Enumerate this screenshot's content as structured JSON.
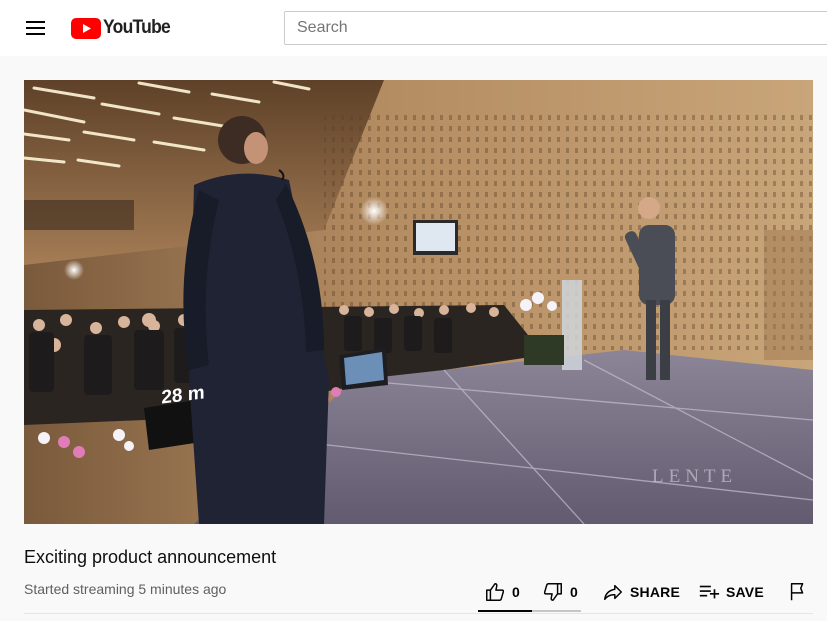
{
  "header": {
    "menu_icon": "hamburger-menu-icon",
    "logo_text": "YouTube",
    "logo_icon": "youtube-play-icon",
    "brand_color": "#FF0000",
    "search": {
      "placeholder": "Search",
      "value": ""
    }
  },
  "player": {
    "overlay_sign_text": "28 m",
    "watermark_text": "LENTE"
  },
  "video": {
    "title": "Exciting product announcement",
    "status": "Started streaming 5 minutes ago"
  },
  "actions": {
    "like_count": "0",
    "dislike_count": "0",
    "share_label": "SHARE",
    "save_label": "SAVE",
    "like_icon": "thumbs-up-icon",
    "dislike_icon": "thumbs-down-icon",
    "share_icon": "share-arrow-icon",
    "save_icon": "playlist-add-icon",
    "report_icon": "flag-icon"
  }
}
